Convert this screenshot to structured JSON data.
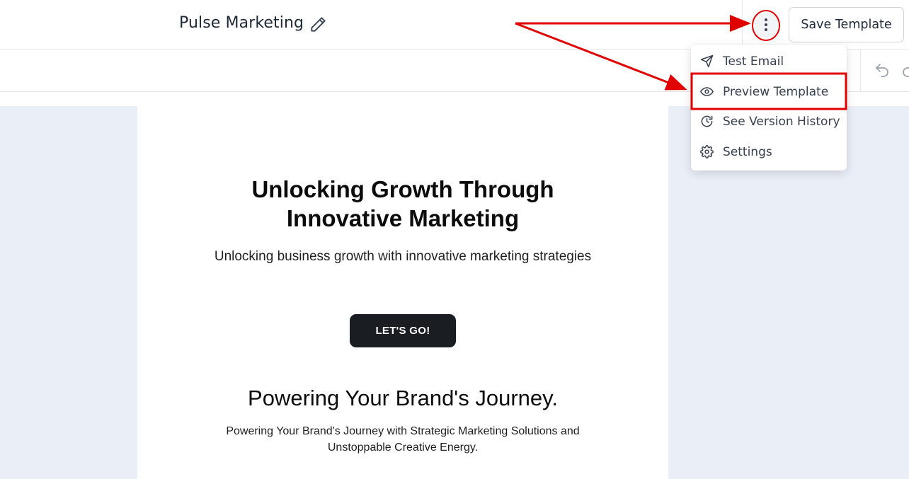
{
  "header": {
    "title": "Pulse Marketing",
    "save_label": "Save Template",
    "edit_icon": "pencil-icon",
    "more_icon": "more-vertical-icon"
  },
  "toolbar": {
    "undo_icon": "undo-icon",
    "redo_icon": "redo-icon"
  },
  "menu": {
    "items": [
      {
        "label": "Test Email",
        "icon": "send-icon"
      },
      {
        "label": "Preview Template",
        "icon": "eye-icon"
      },
      {
        "label": "See Version History",
        "icon": "history-icon"
      },
      {
        "label": "Settings",
        "icon": "gear-icon"
      }
    ]
  },
  "email": {
    "hero_title_line1": "Unlocking Growth Through",
    "hero_title_line2": "Innovative Marketing",
    "hero_subtitle": "Unlocking business growth with innovative marketing strategies",
    "cta_label": "LET'S GO!",
    "section_title": "Powering Your Brand's Journey.",
    "section_text_line1": "Powering Your Brand's Journey with Strategic Marketing Solutions and",
    "section_text_line2": "Unstoppable Creative Energy."
  },
  "colors": {
    "annotation": "#e00000",
    "canvas_bg": "#eaeef6",
    "cta_bg": "#1a1d21"
  }
}
